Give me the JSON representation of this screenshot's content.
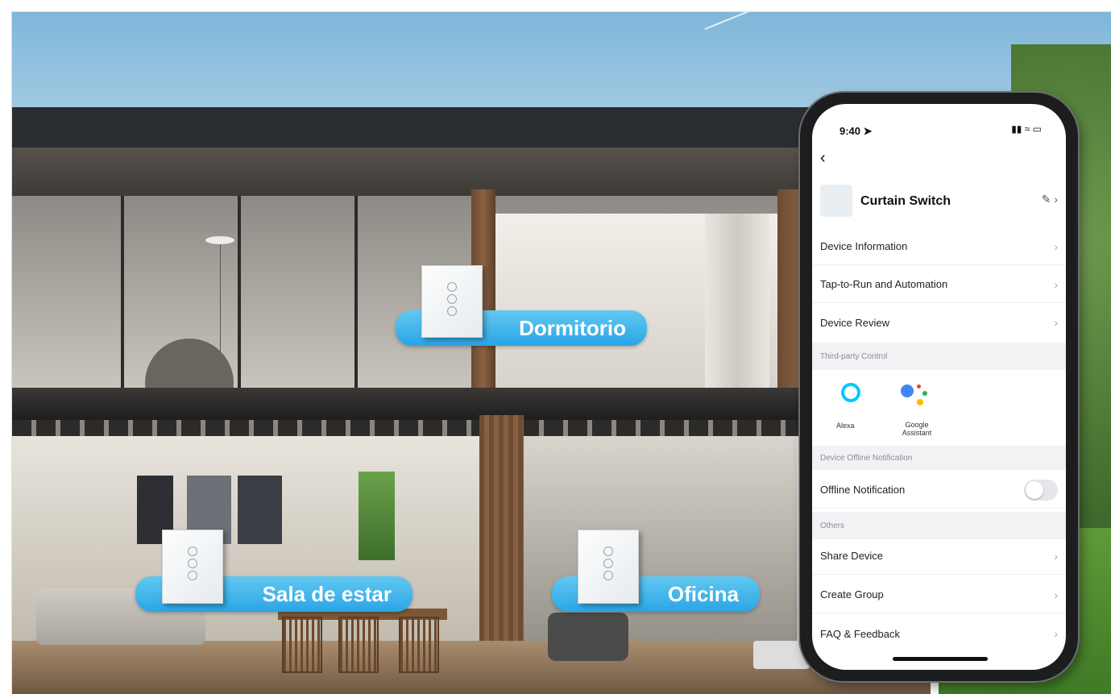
{
  "labels": {
    "bedroom": "Dormitorio",
    "living": "Sala de estar",
    "office": "Oficina"
  },
  "phone": {
    "time": "9:40",
    "device_name": "Curtain Switch",
    "menu": [
      "Device Information",
      "Tap-to-Run and Automation",
      "Device Review"
    ],
    "third_party_header": "Third-party Control",
    "alexa": "Alexa",
    "google": "Google\nAssistant",
    "offline_header": "Device Offline Notification",
    "offline_label": "Offline Notification",
    "others_header": "Others",
    "others": [
      "Share Device",
      "Create Group",
      "FAQ & Feedback"
    ]
  },
  "colors": {
    "pill": "#2aa5e6",
    "alexa": "#00caff"
  }
}
